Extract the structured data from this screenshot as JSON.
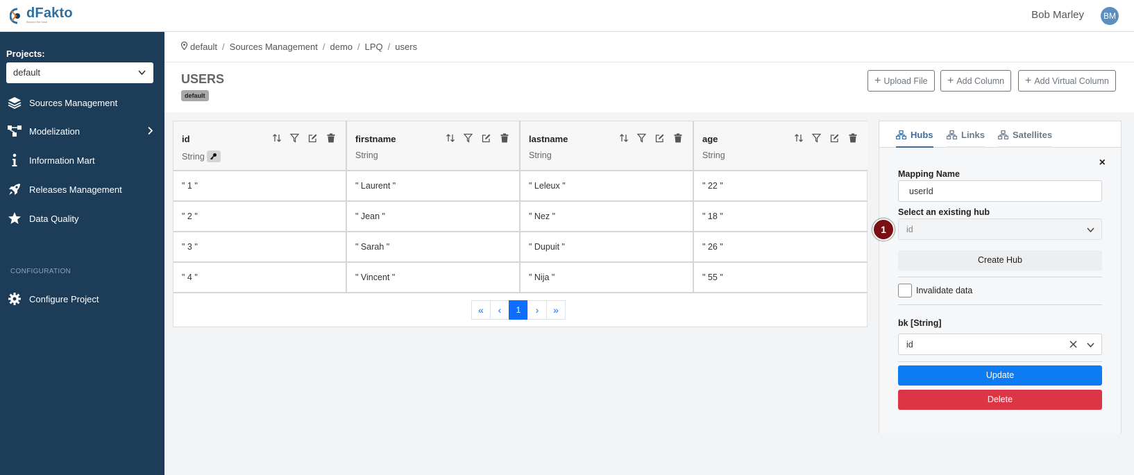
{
  "header": {
    "logo_name": "dFakto",
    "logo_tagline": "Beyond the Data",
    "user_name": "Bob Marley",
    "user_initials": "BM"
  },
  "sidebar": {
    "projects_label": "Projects:",
    "project_selected": "default",
    "items": [
      {
        "label": "Sources Management",
        "icon": "layers-icon"
      },
      {
        "label": "Modelization",
        "icon": "diagram-icon"
      },
      {
        "label": "Information Mart",
        "icon": "info-icon"
      },
      {
        "label": "Releases Management",
        "icon": "rocket-icon"
      },
      {
        "label": "Data Quality",
        "icon": "star-icon"
      }
    ],
    "config_label": "CONFIGURATION",
    "config_item": "Configure Project"
  },
  "breadcrumb": [
    "default",
    "Sources Management",
    "demo",
    "LPQ",
    "users"
  ],
  "page": {
    "title": "USERS",
    "tag": "default",
    "upload_file": "Upload File",
    "add_column": "Add Column",
    "add_virtual_column": "Add Virtual Column"
  },
  "table": {
    "columns": [
      {
        "name": "id",
        "type": "String",
        "key": true
      },
      {
        "name": "firstname",
        "type": "String",
        "key": false
      },
      {
        "name": "lastname",
        "type": "String",
        "key": false
      },
      {
        "name": "age",
        "type": "String",
        "key": false
      }
    ],
    "rows": [
      [
        "\" 1 \"",
        "\" Laurent \"",
        "\" Leleux \"",
        "\" 22 \""
      ],
      [
        "\" 2 \"",
        "\" Jean \"",
        "\" Nez \"",
        "\" 18 \""
      ],
      [
        "\" 3 \"",
        "\" Sarah \"",
        "\" Dupuit \"",
        "\" 26 \""
      ],
      [
        "\" 4 \"",
        "\" Vincent \"",
        "\" Nija \"",
        "\" 55 \""
      ]
    ],
    "pager": {
      "first": "«",
      "prev": "‹",
      "current": "1",
      "next": "›",
      "last": "»"
    }
  },
  "panel": {
    "tabs": [
      "Hubs",
      "Links",
      "Satellites"
    ],
    "active_tab": "Hubs",
    "close": "×",
    "mapping_name_label": "Mapping Name",
    "mapping_name_value": "userId",
    "existing_hub_label": "Select an existing hub",
    "existing_hub_value": "id",
    "badge": "1",
    "create_hub": "Create Hub",
    "invalidate_label": "Invalidate data",
    "invalidate_checked": false,
    "bk_label": "bk [String]",
    "bk_value": "id",
    "update": "Update",
    "delete": "Delete"
  },
  "colors": {
    "sidebar_bg": "#1d3c58",
    "primary": "#0d7bf2",
    "danger": "#dc3545",
    "badge": "#7a0f14"
  }
}
